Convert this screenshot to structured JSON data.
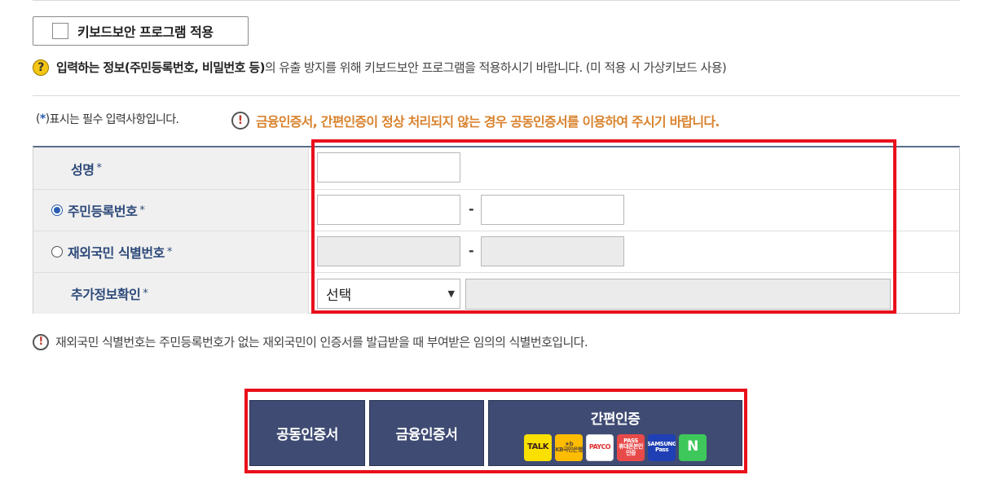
{
  "keyboard_security": {
    "label": "키보드보안 프로그램 적용",
    "checked": false
  },
  "notice": {
    "bold": "입력하는 정보(주민등록번호, 비밀번호 등)",
    "rest": "의 유출 방지를 위해 키보드보안 프로그램을 적용하시기 바랍니다. (미 적용 시 가상키보드 사용)"
  },
  "required": {
    "open": "(",
    "mark": "*",
    "close": ")",
    "text": " 표시는 필수 입력사항입니다."
  },
  "warning": "금융인증서, 간편인증이 정상 처리되지 않는 경우 공동인증서를 이용하여 주시기 바랍니다.",
  "form": {
    "name_label": "성명",
    "resident_label": "주민등록번호",
    "overseas_label": "재외국민 식별번호",
    "extra_label": "추가정보확인",
    "required_mark": "*",
    "dash": "-",
    "select_value": "선택",
    "select_arrow": "▼",
    "resident_selected": true,
    "overseas_selected": false
  },
  "footnote": "재외국민 식별번호는 주민등록번호가 없는 재외국민이 인증서를 발급받을 때 부여받은 임의의 식별번호입니다.",
  "buttons": {
    "joint": "공동인증서",
    "finance": "금융인증서",
    "simple": "간편인증"
  },
  "simple_auth_icons": [
    {
      "name": "kakaotalk",
      "text": "TALK",
      "bg": "#f9e000",
      "fg": "#3c1e1e"
    },
    {
      "name": "kb",
      "text": "★b\nKB국민은행",
      "bg": "#ffbc00",
      "fg": "#5a4a3a"
    },
    {
      "name": "payco",
      "text": "PAYCO",
      "bg": "#ffffff",
      "fg": "#e03030"
    },
    {
      "name": "pass",
      "text": "PASS\n휴대폰본인인증",
      "bg": "#e84a4a",
      "fg": "#ffffff"
    },
    {
      "name": "samsung-pass",
      "text": "SAMSUNG\nPass",
      "bg": "#1f3fb5",
      "fg": "#ffffff"
    },
    {
      "name": "naver",
      "text": "N",
      "bg": "#3ec75b",
      "fg": "#ffffff"
    }
  ],
  "icons": {
    "question": "?",
    "exclamation": "!"
  },
  "colors": {
    "accent_red": "#e8101b",
    "button_navy": "#3f4b73",
    "label_blue": "#2e4a7a",
    "warning_orange": "#d9832e"
  }
}
